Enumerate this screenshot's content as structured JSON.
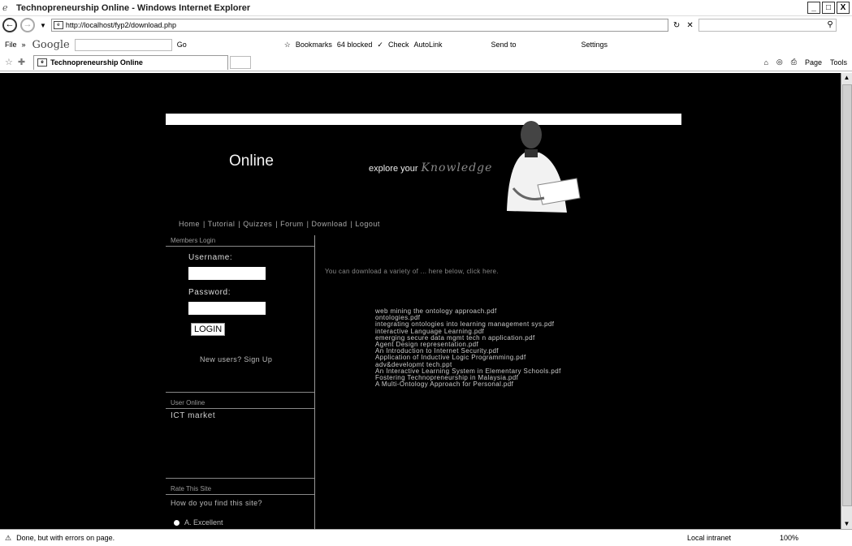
{
  "window": {
    "title": "Technopreneurship Online - Windows Internet Explorer",
    "controls": [
      "_",
      "□",
      "X"
    ]
  },
  "address": {
    "url": "http://localhost/fyp2/download.php"
  },
  "toolbar": {
    "file": "File",
    "google": "Google",
    "go": "Go",
    "bookmarks": "Bookmarks",
    "blocked": "64 blocked",
    "check": "Check",
    "autolink": "AutoLink",
    "sendto": "Send to",
    "settings": "Settings"
  },
  "tabs": {
    "active": "Technopreneurship Online",
    "page": "Page",
    "tools": "Tools"
  },
  "site": {
    "logo": "Online",
    "slogan": "explore your",
    "slogan_em": "Knowledge",
    "nav": [
      "Home",
      "Tutorial",
      "Quizzes",
      "Forum",
      "Download",
      "Logout"
    ]
  },
  "sidebar": {
    "members_login": "Members Login",
    "username_label": "Username:",
    "password_label": "Password:",
    "login_button": "LOGIN",
    "signup": "New users? Sign Up",
    "user_online": "User Online",
    "ict_market": "ICT market",
    "rate_site": "Rate This Site",
    "poll_question": "How do you find this site?",
    "poll_option": "A. Excellent"
  },
  "main": {
    "intro": "You can download a variety of ... here below, click here.",
    "files": [
      "web mining the ontology approach.pdf",
      "ontologies.pdf",
      "integrating ontologies into learning management sys.pdf",
      "interactive Language Learning.pdf",
      "emerging secure data mgmt tech n application.pdf",
      "Agent Design representation.pdf",
      "An Introduction to Internet Security.pdf",
      "Application of Inductive Logic Programming.pdf",
      "adv&developmt tech.ppt",
      "An Interactive Learning System in Elementary Schools.pdf",
      "Fostering Technopreneurship in Malaysia.pdf",
      "A Multi-Ontology Approach for Personal.pdf"
    ]
  },
  "status": {
    "text": "Done, but with errors on page.",
    "zone": "Local intranet",
    "zoom": "100%"
  }
}
